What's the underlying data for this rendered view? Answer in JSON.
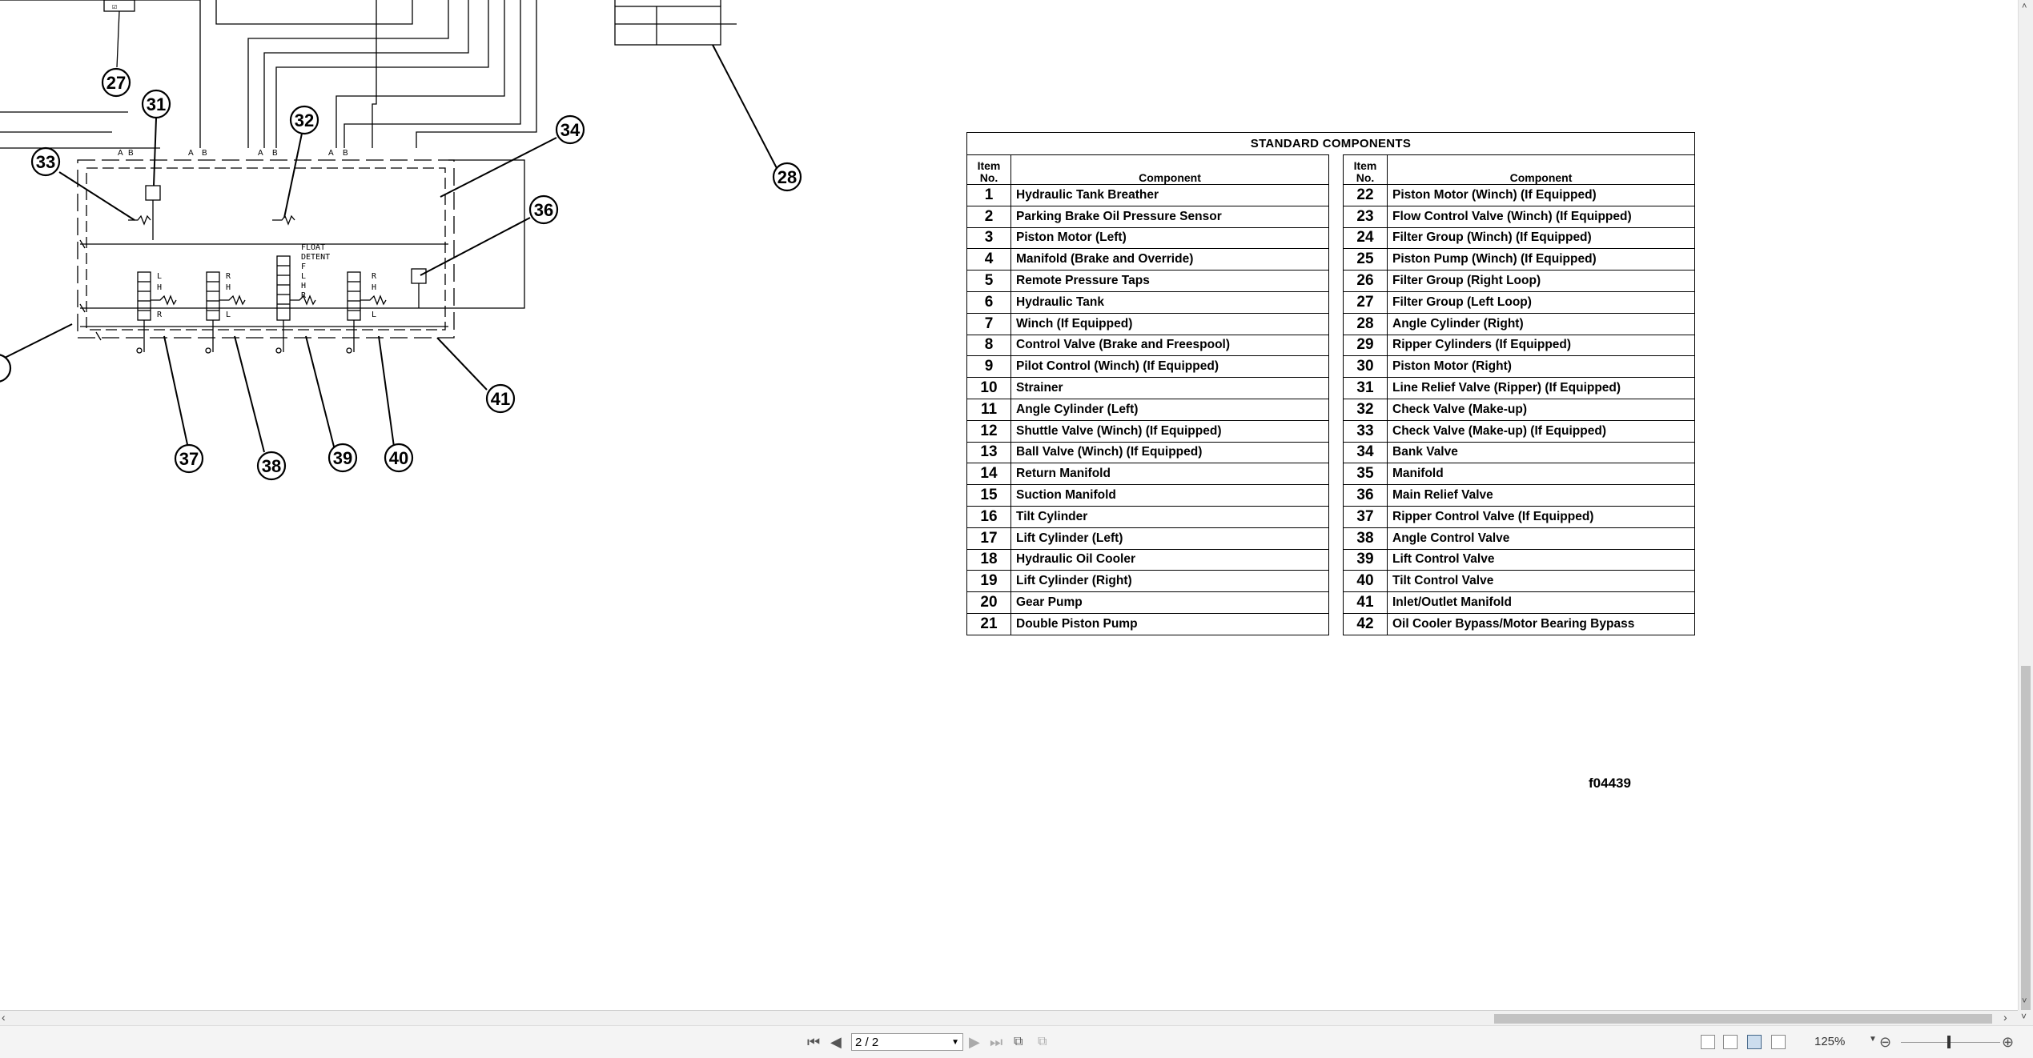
{
  "table": {
    "title": "STANDARD COMPONENTS",
    "header_item": "Item No.",
    "header_component": "Component",
    "left": [
      {
        "no": "1",
        "name": "Hydraulic Tank Breather"
      },
      {
        "no": "2",
        "name": "Parking Brake Oil Pressure Sensor"
      },
      {
        "no": "3",
        "name": "Piston Motor (Left)"
      },
      {
        "no": "4",
        "name": "Manifold (Brake and Override)"
      },
      {
        "no": "5",
        "name": "Remote Pressure Taps"
      },
      {
        "no": "6",
        "name": "Hydraulic Tank"
      },
      {
        "no": "7",
        "name": "Winch (If Equipped)"
      },
      {
        "no": "8",
        "name": "Control Valve (Brake and Freespool)"
      },
      {
        "no": "9",
        "name": "Pilot Control (Winch) (If Equipped)"
      },
      {
        "no": "10",
        "name": "Strainer"
      },
      {
        "no": "11",
        "name": "Angle Cylinder (Left)"
      },
      {
        "no": "12",
        "name": "Shuttle Valve (Winch) (If Equipped)"
      },
      {
        "no": "13",
        "name": "Ball Valve (Winch) (If Equipped)"
      },
      {
        "no": "14",
        "name": "Return Manifold"
      },
      {
        "no": "15",
        "name": "Suction Manifold"
      },
      {
        "no": "16",
        "name": "Tilt Cylinder"
      },
      {
        "no": "17",
        "name": "Lift Cylinder (Left)"
      },
      {
        "no": "18",
        "name": "Hydraulic Oil Cooler"
      },
      {
        "no": "19",
        "name": "Lift Cylinder (Right)"
      },
      {
        "no": "20",
        "name": "Gear Pump"
      },
      {
        "no": "21",
        "name": "Double Piston Pump"
      }
    ],
    "right": [
      {
        "no": "22",
        "name": "Piston Motor (Winch) (If Equipped)"
      },
      {
        "no": "23",
        "name": "Flow Control Valve (Winch) (If Equipped)"
      },
      {
        "no": "24",
        "name": "Filter Group (Winch) (If Equipped)"
      },
      {
        "no": "25",
        "name": "Piston Pump (Winch) (If Equipped)"
      },
      {
        "no": "26",
        "name": "Filter Group (Right Loop)"
      },
      {
        "no": "27",
        "name": "Filter Group (Left Loop)"
      },
      {
        "no": "28",
        "name": "Angle Cylinder (Right)"
      },
      {
        "no": "29",
        "name": "Ripper Cylinders (If Equipped)"
      },
      {
        "no": "30",
        "name": "Piston Motor (Right)"
      },
      {
        "no": "31",
        "name": "Line Relief Valve (Ripper) (If Equipped)"
      },
      {
        "no": "32",
        "name": "Check Valve (Make-up)"
      },
      {
        "no": "33",
        "name": "Check Valve (Make-up) (If Equipped)"
      },
      {
        "no": "34",
        "name": "Bank Valve"
      },
      {
        "no": "35",
        "name": "Manifold"
      },
      {
        "no": "36",
        "name": "Main Relief Valve"
      },
      {
        "no": "37",
        "name": "Ripper Control Valve (If Equipped)"
      },
      {
        "no": "38",
        "name": "Angle Control Valve"
      },
      {
        "no": "39",
        "name": "Lift Control Valve"
      },
      {
        "no": "40",
        "name": "Tilt Control Valve"
      },
      {
        "no": "41",
        "name": "Inlet/Outlet Manifold"
      },
      {
        "no": "42",
        "name": "Oil Cooler Bypass/Motor Bearing Bypass"
      }
    ]
  },
  "figure_code": "f04439",
  "schematic": {
    "callouts": [
      "27",
      "31",
      "32",
      "33",
      "34",
      "36",
      "37",
      "38",
      "39",
      "40",
      "41",
      "28"
    ],
    "port_labels": [
      "A",
      "B"
    ],
    "float_label": "FLOAT DETENT",
    "spool_letters": [
      "L",
      "H",
      "R",
      "R",
      "H",
      "L",
      "F",
      "L",
      "H",
      "R",
      "R",
      "H",
      "L"
    ]
  },
  "toolbar": {
    "page_indicator": "2 / 2",
    "zoom": "125%"
  },
  "icons": {
    "first_page": "first-page-icon",
    "prev_page": "prev-page-icon",
    "next_page": "next-page-icon",
    "last_page": "last-page-icon",
    "zoom_out": "zoom-out-icon",
    "zoom_in": "zoom-in-icon"
  },
  "colors": {
    "page_bg": "#ffffff",
    "chrome_bg": "#f0f0f0",
    "scroll_thumb": "#c2c2c2"
  }
}
